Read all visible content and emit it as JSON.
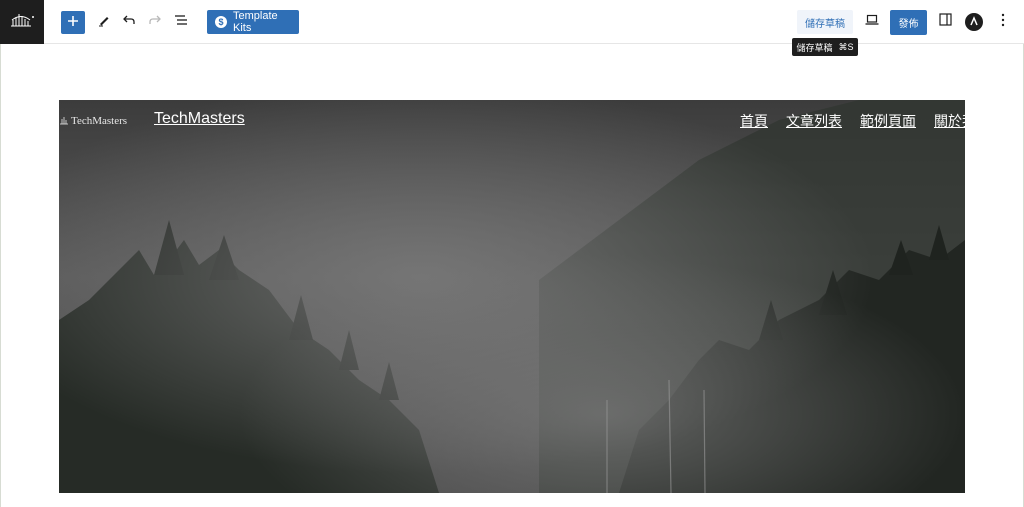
{
  "toolbar": {
    "template_kits_label": "Template Kits",
    "save_draft_label": "儲存草稿",
    "publish_label": "發佈",
    "tooltip": {
      "label": "儲存草稿",
      "shortcut": "⌘S"
    }
  },
  "hero": {
    "logo_text": "TechMasters",
    "site_title": "TechMasters",
    "nav_items": [
      "首頁",
      "文章列表",
      "範例頁面",
      "關於我們"
    ]
  },
  "colors": {
    "accent": "#2f6fb6",
    "dark": "#1e1e1e"
  },
  "icons": [
    "site-logo-icon",
    "plus-icon",
    "pen-icon",
    "undo-icon",
    "redo-icon",
    "list-view-icon",
    "laptop-icon",
    "sidebar-toggle-icon",
    "plugin-icon",
    "more-vertical-icon"
  ]
}
